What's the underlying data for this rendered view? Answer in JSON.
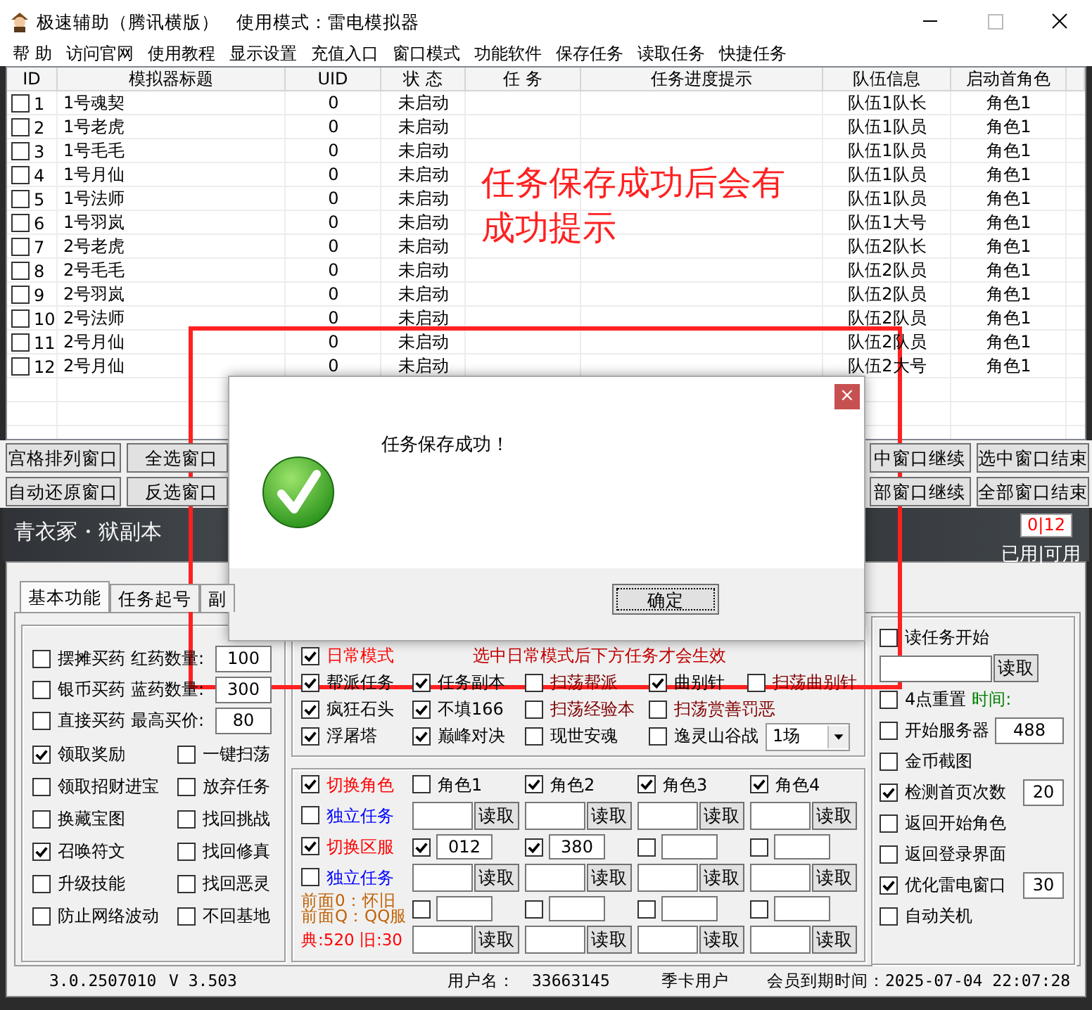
{
  "window": {
    "title": "极速辅助（腾讯横版）",
    "mode": "使用模式：雷电模拟器"
  },
  "menu": [
    "帮 助",
    "访问官网",
    "使用教程",
    "显示设置",
    "充值入口",
    "窗口模式",
    "功能软件",
    "保存任务",
    "读取任务",
    "快捷任务"
  ],
  "table": {
    "columns": [
      "ID",
      "模拟器标题",
      "UID",
      "状 态",
      "任 务",
      "任务进度提示",
      "队伍信息",
      "启动首角色"
    ],
    "rows": [
      {
        "checked": false,
        "id": "1",
        "title": "1号魂契",
        "uid": "0",
        "status": "未启动",
        "team": "队伍1队长",
        "role": "角色1"
      },
      {
        "checked": false,
        "id": "2",
        "title": "1号老虎",
        "uid": "0",
        "status": "未启动",
        "team": "队伍1队员",
        "role": "角色1"
      },
      {
        "checked": false,
        "id": "3",
        "title": "1号毛毛",
        "uid": "0",
        "status": "未启动",
        "team": "队伍1队员",
        "role": "角色1"
      },
      {
        "checked": false,
        "id": "4",
        "title": "1号月仙",
        "uid": "0",
        "status": "未启动",
        "team": "队伍1队员",
        "role": "角色1"
      },
      {
        "checked": false,
        "id": "5",
        "title": "1号法师",
        "uid": "0",
        "status": "未启动",
        "team": "队伍1队员",
        "role": "角色1"
      },
      {
        "checked": false,
        "id": "6",
        "title": "1号羽岚",
        "uid": "0",
        "status": "未启动",
        "team": "队伍1大号",
        "role": "角色1"
      },
      {
        "checked": false,
        "id": "7",
        "title": "2号老虎",
        "uid": "0",
        "status": "未启动",
        "team": "队伍2队长",
        "role": "角色1"
      },
      {
        "checked": false,
        "id": "8",
        "title": "2号毛毛",
        "uid": "0",
        "status": "未启动",
        "team": "队伍2队员",
        "role": "角色1"
      },
      {
        "checked": false,
        "id": "9",
        "title": "2号羽岚",
        "uid": "0",
        "status": "未启动",
        "team": "队伍2队员",
        "role": "角色1"
      },
      {
        "checked": false,
        "id": "10",
        "title": "2号法师",
        "uid": "0",
        "status": "未启动",
        "team": "队伍2队员",
        "role": "角色1"
      },
      {
        "checked": false,
        "id": "11",
        "title": "2号月仙",
        "uid": "0",
        "status": "未启动",
        "team": "队伍2队员",
        "role": "角色1"
      },
      {
        "checked": false,
        "id": "12",
        "title": "2号月仙",
        "uid": "0",
        "status": "未启动",
        "team": "队伍2大号",
        "role": "角色1"
      }
    ]
  },
  "annotation": "任务保存成功后会有成功提示",
  "button_rows": [
    {
      "left": [
        "宫格排列窗口",
        "全选窗口"
      ],
      "right": [
        "中窗口继续",
        "选中窗口结束"
      ]
    },
    {
      "left": [
        "自动还原窗口",
        "反选窗口"
      ],
      "right": [
        "部窗口继续",
        "全部窗口结束"
      ]
    }
  ],
  "banner": {
    "title": "青衣冢・狱副本",
    "counts": "0|12",
    "legend": "已用|可用"
  },
  "tabs": [
    {
      "label": "基本功能",
      "selected": true
    },
    {
      "label": "任务起号",
      "selected": false
    },
    {
      "label": "副",
      "selected": false
    }
  ],
  "buy_rows": [
    {
      "label": "摆摊买药",
      "checked": false,
      "field_label": "红药数量:",
      "value": "100"
    },
    {
      "label": "银币买药",
      "checked": false,
      "field_label": "蓝药数量:",
      "value": "300"
    },
    {
      "label": "直接买药",
      "checked": false,
      "field_label": "最高买价:",
      "value": "80"
    }
  ],
  "options": [
    {
      "label": "领取奖励",
      "checked": true
    },
    {
      "label": "一键扫荡",
      "checked": false
    },
    {
      "label": "领取招财进宝",
      "checked": false
    },
    {
      "label": "放弃任务",
      "checked": false
    },
    {
      "label": "换藏宝图",
      "checked": false
    },
    {
      "label": "找回挑战",
      "checked": false
    },
    {
      "label": "召唤符文",
      "checked": true
    },
    {
      "label": "找回修真",
      "checked": false
    },
    {
      "label": "升级技能",
      "checked": false
    },
    {
      "label": "找回恶灵",
      "checked": false
    },
    {
      "label": "防止网络波动",
      "checked": false
    },
    {
      "label": "不回基地",
      "checked": false
    }
  ],
  "daily_mode": {
    "label": "日常模式",
    "checked": true,
    "hint": "选中日常模式后下方任务才会生效"
  },
  "task_rows": [
    [
      {
        "kind": "checkbox",
        "label": "帮派任务",
        "checked": true,
        "color": "#000000"
      },
      {
        "kind": "checkbox",
        "label": "任务副本",
        "checked": true,
        "color": "#000000"
      },
      {
        "kind": "checkbox",
        "label": "扫荡帮派",
        "checked": false,
        "color": "#800000"
      },
      {
        "kind": "checkbox",
        "label": "曲别针",
        "checked": true,
        "color": "#000000"
      },
      {
        "kind": "checkbox",
        "label": "扫荡曲别针",
        "checked": false,
        "color": "#800000"
      }
    ],
    [
      {
        "kind": "checkbox",
        "label": "疯狂石头",
        "checked": true,
        "color": "#000000"
      },
      {
        "kind": "checkbox",
        "label": "不填166",
        "checked": true,
        "color": "#000000"
      },
      {
        "kind": "checkbox",
        "label": "扫荡经验本",
        "checked": false,
        "color": "#800000"
      },
      {
        "kind": "checkbox",
        "label": "扫荡赏善罚恶",
        "checked": false,
        "color": "#800000"
      }
    ],
    [
      {
        "kind": "checkbox",
        "label": "浮屠塔",
        "checked": true,
        "color": "#000000"
      },
      {
        "kind": "checkbox",
        "label": "巅峰对决",
        "checked": true,
        "color": "#000000"
      },
      {
        "kind": "checkbox",
        "label": "现世安魂",
        "checked": false,
        "color": "#000000"
      },
      {
        "kind": "checkbox",
        "label": "逸灵山谷战",
        "checked": false,
        "color": "#000000"
      },
      {
        "kind": "select",
        "value": "1场"
      }
    ]
  ],
  "switch_rows": [
    {
      "kind": "toggle",
      "label": "切换角色",
      "checked": true,
      "color": "#ff0000",
      "cells": [
        {
          "kind": "checkbox",
          "label": "角色1",
          "checked": false
        },
        {
          "kind": "checkbox",
          "label": "角色2",
          "checked": true
        },
        {
          "kind": "checkbox",
          "label": "角色3",
          "checked": true
        },
        {
          "kind": "checkbox",
          "label": "角色4",
          "checked": true
        }
      ]
    },
    {
      "kind": "toggle",
      "label": "独立任务",
      "checked": false,
      "color": "#0000ff",
      "cells": [
        {
          "kind": "read",
          "button": "读取"
        },
        {
          "kind": "read",
          "button": "读取"
        },
        {
          "kind": "read",
          "button": "读取"
        },
        {
          "kind": "read",
          "button": "读取"
        }
      ]
    },
    {
      "kind": "toggle",
      "label": "切换区服",
      "checked": true,
      "color": "#ff0000",
      "cells": [
        {
          "kind": "check_field",
          "checked": true,
          "value": "012"
        },
        {
          "kind": "check_field",
          "checked": true,
          "value": "380"
        },
        {
          "kind": "check_field",
          "checked": false
        },
        {
          "kind": "check_field",
          "checked": false
        }
      ]
    },
    {
      "kind": "toggle",
      "label": "独立任务",
      "checked": false,
      "color": "#0000ff",
      "cells": [
        {
          "kind": "read",
          "button": "读取"
        },
        {
          "kind": "read",
          "button": "读取"
        },
        {
          "kind": "read",
          "button": "读取"
        },
        {
          "kind": "read",
          "button": "读取"
        }
      ]
    },
    {
      "kind": "note",
      "lines": [
        "前面0：怀旧",
        "前面Q：QQ服"
      ],
      "color": "#c06000",
      "cells": [
        {
          "kind": "check_field",
          "checked": false
        },
        {
          "kind": "check_field",
          "checked": false
        },
        {
          "kind": "check_field",
          "checked": false
        },
        {
          "kind": "check_field",
          "checked": false
        }
      ]
    },
    {
      "kind": "note",
      "lines": [
        "典:520 旧:30"
      ],
      "color": "#ff0000",
      "cells": [
        {
          "kind": "read",
          "button": "读取"
        },
        {
          "kind": "read",
          "button": "读取"
        },
        {
          "kind": "read",
          "button": "读取"
        },
        {
          "kind": "read",
          "button": "读取"
        }
      ]
    }
  ],
  "right_panel": [
    {
      "kind": "checkbox",
      "label": "读任务开始",
      "checked": false
    },
    {
      "kind": "read",
      "button": "读取"
    },
    {
      "kind": "checkbox",
      "label": "4点重置",
      "checked": false,
      "note": "时间:"
    },
    {
      "kind": "checkbox",
      "label": "开始服务器",
      "checked": false,
      "value": "488"
    },
    {
      "kind": "checkbox",
      "label": "金币截图",
      "checked": false
    },
    {
      "kind": "checkbox",
      "label": "检测首页次数",
      "checked": true,
      "value": "20"
    },
    {
      "kind": "checkbox",
      "label": "返回开始角色",
      "checked": false
    },
    {
      "kind": "checkbox",
      "label": "返回登录界面",
      "checked": false
    },
    {
      "kind": "checkbox",
      "label": "优化雷电窗口",
      "checked": true,
      "value": "30"
    },
    {
      "kind": "checkbox",
      "label": "自动关机",
      "checked": false
    }
  ],
  "status_bar": [
    "3.0.2507010",
    "V 3.503",
    "用户名：",
    "33663145",
    "季卡用户",
    "会员到期时间：2025-07-04 22:07:28"
  ],
  "dialog": {
    "close": "×",
    "message": "任务保存成功！",
    "button": "确定"
  }
}
